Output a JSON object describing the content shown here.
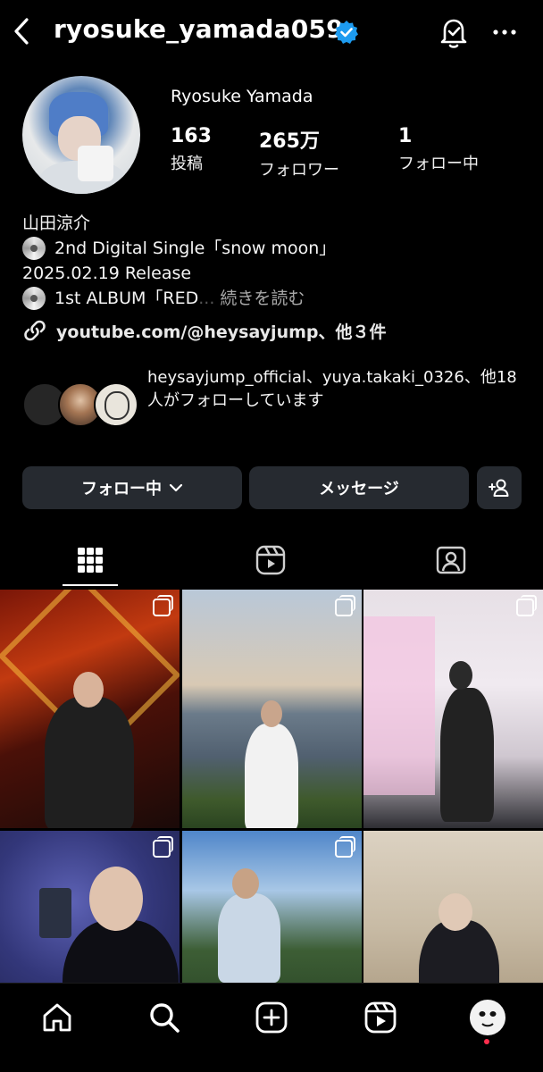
{
  "header": {
    "username": "ryosuke_yamada059",
    "verified_icon": "verified-badge-icon",
    "back_icon": "chevron-left-icon",
    "bell_icon": "notification-bell-icon",
    "more_icon": "more-horizontal-icon"
  },
  "profile": {
    "display_name": "Ryosuke Yamada",
    "stats": [
      {
        "value": "163",
        "label": "投稿"
      },
      {
        "value": "265万",
        "label": "フォロワー"
      },
      {
        "value": "1",
        "label": "フォロー中"
      }
    ]
  },
  "bio": {
    "line1": "山田涼介",
    "line2": "2nd Digital Single「snow moon」",
    "line3": "2025.02.19 Release",
    "line4_prefix": "1st ALBUM「RED",
    "line4_fade": "...",
    "line4_more": "続きを読む",
    "link": "youtube.com/@heysayjump、他３件"
  },
  "followed_by": {
    "text": "heysayjump_official、yuya.takaki_0326、他18人がフォローしています"
  },
  "actions": {
    "following_label": "フォロー中",
    "message_label": "メッセージ",
    "add_user_icon": "add-user-icon"
  },
  "tabs": [
    {
      "name": "grid",
      "icon": "grid-icon",
      "active": true
    },
    {
      "name": "reels",
      "icon": "reels-icon",
      "active": false
    },
    {
      "name": "tagged",
      "icon": "tagged-user-icon",
      "active": false
    }
  ],
  "bottom_nav": [
    {
      "name": "home",
      "icon": "home-icon"
    },
    {
      "name": "search",
      "icon": "search-icon"
    },
    {
      "name": "create",
      "icon": "plus-square-icon"
    },
    {
      "name": "reels",
      "icon": "reels-icon"
    },
    {
      "name": "profile",
      "icon": "profile-avatar-icon"
    }
  ],
  "colors": {
    "background": "#000000",
    "button": "#262a30",
    "verified": "#1d9bf0",
    "muted": "#a8a8a8",
    "notification_dot": "#ff2e4d"
  }
}
